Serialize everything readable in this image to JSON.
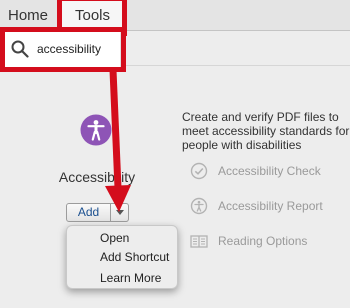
{
  "tabs": {
    "home": "Home",
    "tools": "Tools"
  },
  "search": {
    "value": "accessibility",
    "icon": "search-icon"
  },
  "tool": {
    "name": "Accessibility",
    "icon": "accessibility-icon",
    "accent_color": "#8e54b6",
    "add_label": "Add",
    "description": "Create and verify PDF files to meet accessibility standards for people with disabilities"
  },
  "subtools": [
    {
      "label": "Accessibility Check",
      "icon": "check-circle-icon"
    },
    {
      "label": "Accessibility Report",
      "icon": "accessibility-person-icon"
    },
    {
      "label": "Reading Options",
      "icon": "reading-options-icon"
    }
  ],
  "menu": {
    "items": [
      "Open",
      "Add Shortcut",
      "Learn More"
    ]
  },
  "annotation": {
    "color": "#d40d1c"
  }
}
